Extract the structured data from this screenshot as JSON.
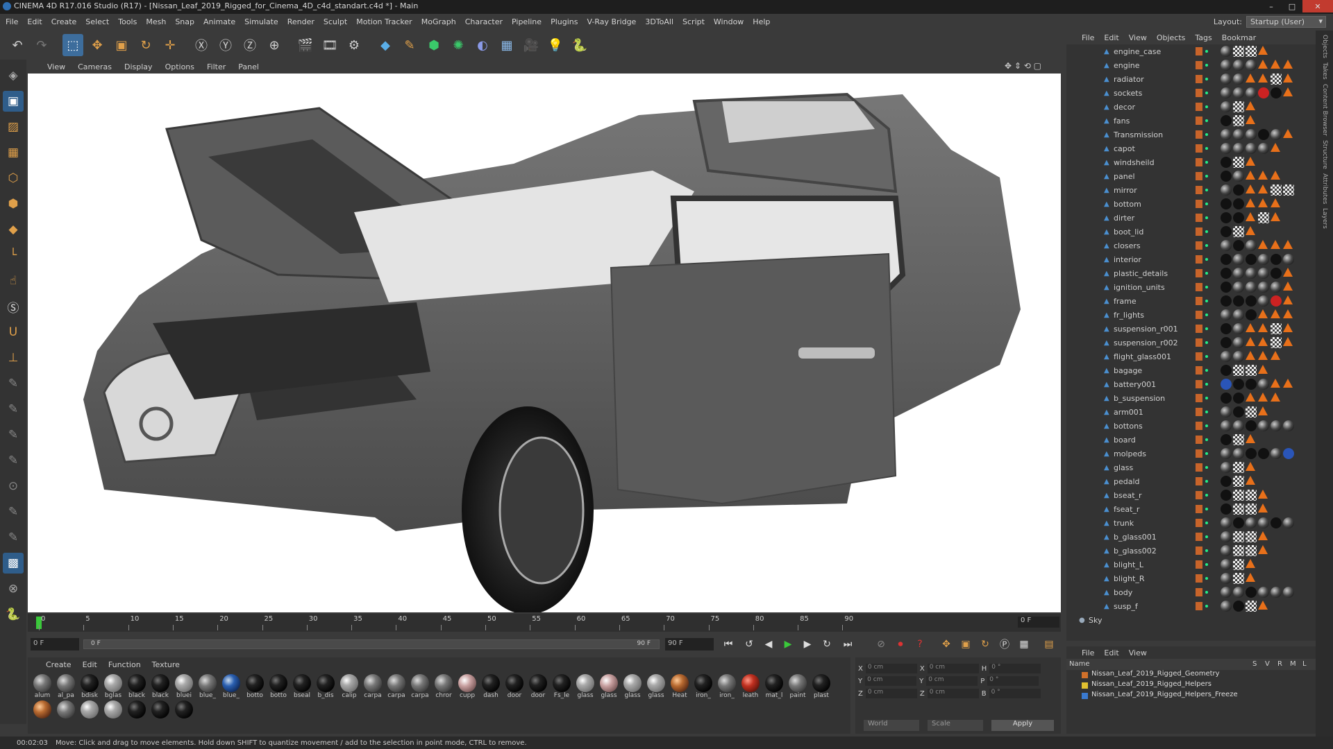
{
  "window": {
    "title": "CINEMA 4D R17.016 Studio (R17) - [Nissan_Leaf_2019_Rigged_for_Cinema_4D_c4d_standart.c4d *] - Main"
  },
  "menu": [
    "File",
    "Edit",
    "Create",
    "Select",
    "Tools",
    "Mesh",
    "Snap",
    "Animate",
    "Simulate",
    "Render",
    "Sculpt",
    "Motion Tracker",
    "MoGraph",
    "Character",
    "Pipeline",
    "Plugins",
    "V-Ray Bridge",
    "3DToAll",
    "Script",
    "Window",
    "Help"
  ],
  "layout": {
    "label": "Layout:",
    "value": "Startup (User)"
  },
  "viewport_menu": [
    "View",
    "Cameras",
    "Display",
    "Options",
    "Filter",
    "Panel"
  ],
  "timeline": {
    "ticks": [
      "0",
      "5",
      "10",
      "15",
      "20",
      "25",
      "30",
      "35",
      "40",
      "45",
      "50",
      "55",
      "60",
      "65",
      "70",
      "75",
      "80",
      "85",
      "90"
    ],
    "frame": "0 F"
  },
  "transport": {
    "start": "0 F",
    "slider": "0 F",
    "end_in": "90 F",
    "end": "90 F"
  },
  "materials_menu": [
    "Create",
    "Edit",
    "Function",
    "Texture"
  ],
  "materials": [
    {
      "n": "alum",
      "t": "grey"
    },
    {
      "n": "al_pa",
      "t": "grey"
    },
    {
      "n": "bdisk",
      "t": "dark"
    },
    {
      "n": "bglas",
      "t": "glass"
    },
    {
      "n": "black",
      "t": "dark"
    },
    {
      "n": "black",
      "t": "dark"
    },
    {
      "n": "bluei",
      "t": "glass"
    },
    {
      "n": "blue_",
      "t": "grey"
    },
    {
      "n": "blue_",
      "t": "blue"
    },
    {
      "n": "botto",
      "t": "dark"
    },
    {
      "n": "botto",
      "t": "dark"
    },
    {
      "n": "bseal",
      "t": "dark"
    },
    {
      "n": "b_dis",
      "t": "dark"
    },
    {
      "n": "calip",
      "t": "glass"
    },
    {
      "n": "carpa",
      "t": "grey"
    },
    {
      "n": "carpa",
      "t": "grey"
    },
    {
      "n": "carpa",
      "t": "grey"
    },
    {
      "n": "chror",
      "t": "grey"
    },
    {
      "n": "cupp",
      "t": "pink"
    },
    {
      "n": "dash",
      "t": "dark"
    },
    {
      "n": "door",
      "t": "dark"
    },
    {
      "n": "door",
      "t": "dark"
    },
    {
      "n": "Fs_le",
      "t": "dark"
    },
    {
      "n": "glass",
      "t": "glass"
    },
    {
      "n": "glass",
      "t": "pink"
    },
    {
      "n": "glass",
      "t": "glass"
    },
    {
      "n": "glass",
      "t": "glass"
    },
    {
      "n": "Heat",
      "t": "copper"
    },
    {
      "n": "iron_",
      "t": "dark"
    },
    {
      "n": "iron_",
      "t": "grey"
    },
    {
      "n": "leath",
      "t": "red"
    },
    {
      "n": "mat_l",
      "t": "dark"
    },
    {
      "n": "paint",
      "t": "grey"
    },
    {
      "n": "plast",
      "t": "dark"
    },
    {
      "n": "",
      "t": "copper"
    },
    {
      "n": "",
      "t": "grey"
    },
    {
      "n": "",
      "t": "glass"
    },
    {
      "n": "",
      "t": "glass"
    },
    {
      "n": "",
      "t": "dark"
    },
    {
      "n": "",
      "t": "dark"
    },
    {
      "n": "",
      "t": "dark"
    }
  ],
  "coords": {
    "rows": [
      [
        "X",
        "0 cm",
        "X",
        "0 cm",
        "H",
        "0 °"
      ],
      [
        "Y",
        "0 cm",
        "Y",
        "0 cm",
        "P",
        "0 °"
      ],
      [
        "Z",
        "0 cm",
        "Z",
        "0 cm",
        "B",
        "0 °"
      ]
    ],
    "world": "World",
    "scale": "Scale",
    "apply": "Apply"
  },
  "status": {
    "time": "00:02:03",
    "message": "Move: Click and drag to move elements. Hold down SHIFT to quantize movement / add to the selection in point mode, CTRL to remove."
  },
  "objects_menu": [
    "File",
    "Edit",
    "View",
    "Objects",
    "Tags",
    "Bookmar"
  ],
  "objects": [
    {
      "n": "engine_case",
      "tags": "s,ch,ch,tri"
    },
    {
      "n": "engine",
      "tags": "s,s,s,tri,tri,tri"
    },
    {
      "n": "radiator",
      "tags": "s,s,tri,tri,ch,tri"
    },
    {
      "n": "sockets",
      "tags": "s,s,s,r,d,tri"
    },
    {
      "n": "decor",
      "tags": "s,ch,tri"
    },
    {
      "n": "fans",
      "tags": "d,ch,tri"
    },
    {
      "n": "Transmission",
      "tags": "s,s,s,d,s,tri"
    },
    {
      "n": "capot",
      "tags": "s,s,s,s,tri"
    },
    {
      "n": "windsheild",
      "tags": "d,ch,tri"
    },
    {
      "n": "panel",
      "tags": "d,s,tri,tri,tri"
    },
    {
      "n": "mirror",
      "tags": "s,d,tri,tri,ch,ch"
    },
    {
      "n": "bottom",
      "tags": "d,d,tri,tri,tri"
    },
    {
      "n": "dirter",
      "tags": "d,d,tri,ch,tri"
    },
    {
      "n": "boot_lid",
      "tags": "d,ch,tri"
    },
    {
      "n": "closers",
      "tags": "s,d,s,tri,tri,tri"
    },
    {
      "n": "interior",
      "tags": "d,s,d,s,d,s"
    },
    {
      "n": "plastic_details",
      "tags": "d,s,s,s,d,tri"
    },
    {
      "n": "ignition_units",
      "tags": "d,s,s,s,s,tri"
    },
    {
      "n": "frame",
      "tags": "d,d,d,s,r,tri"
    },
    {
      "n": "fr_lights",
      "tags": "s,s,d,tri,tri,tri"
    },
    {
      "n": "suspension_r001",
      "tags": "d,s,tri,tri,ch,tri"
    },
    {
      "n": "suspension_r002",
      "tags": "d,s,tri,tri,ch,tri"
    },
    {
      "n": "flight_glass001",
      "tags": "s,s,tri,tri,tri"
    },
    {
      "n": "bagage",
      "tags": "d,ch,ch,tri"
    },
    {
      "n": "battery001",
      "tags": "b,d,d,s,tri,tri"
    },
    {
      "n": "b_suspension",
      "tags": "d,d,tri,tri,tri"
    },
    {
      "n": "arm001",
      "tags": "s,d,ch,tri"
    },
    {
      "n": "bottons",
      "tags": "s,s,d,s,s,s"
    },
    {
      "n": "board",
      "tags": "d,ch,tri"
    },
    {
      "n": "molpeds",
      "tags": "s,s,d,d,s,b"
    },
    {
      "n": "glass",
      "tags": "s,ch,tri"
    },
    {
      "n": "pedald",
      "tags": "d,ch,tri"
    },
    {
      "n": "bseat_r",
      "tags": "d,ch,ch,tri"
    },
    {
      "n": "fseat_r",
      "tags": "d,ch,ch,tri"
    },
    {
      "n": "trunk",
      "tags": "s,d,s,s,d,s"
    },
    {
      "n": "b_glass001",
      "tags": "s,ch,ch,tri"
    },
    {
      "n": "b_glass002",
      "tags": "s,ch,ch,tri"
    },
    {
      "n": "blight_L",
      "tags": "s,ch,tri"
    },
    {
      "n": "blight_R",
      "tags": "s,ch,tri"
    },
    {
      "n": "body",
      "tags": "s,s,d,s,s,s"
    },
    {
      "n": "susp_f",
      "tags": "s,d,ch,tri"
    },
    {
      "n": "Sky",
      "tags": ""
    }
  ],
  "layers": {
    "menu": [
      "File",
      "Edit",
      "View"
    ],
    "header": "Name",
    "cols": [
      "S",
      "V",
      "R",
      "M",
      "L"
    ],
    "items": [
      {
        "n": "Nissan_Leaf_2019_Rigged_Geometry",
        "c": "#d0702a"
      },
      {
        "n": "Nissan_Leaf_2019_Rigged_Helpers",
        "c": "#e0c030"
      },
      {
        "n": "Nissan_Leaf_2019_Rigged_Helpers_Freeze",
        "c": "#3a7ad0"
      }
    ]
  },
  "side_tabs": [
    "Objects",
    "Takes",
    "Content Browser",
    "Structure",
    "Attributes",
    "Layers"
  ],
  "colors": {
    "accent": "#3d6d9c",
    "layer_orange": "#c8642a",
    "tag_orange": "#e8701a"
  }
}
